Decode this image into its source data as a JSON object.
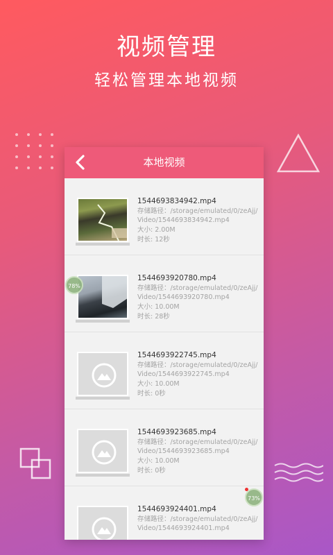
{
  "promo": {
    "headline": "视频管理",
    "subline": "轻松管理本地视频"
  },
  "appbar": {
    "title": "本地视频",
    "back_icon": "chevron-left-icon",
    "color": "#ee5a79"
  },
  "videos": [
    {
      "filename": "1544693834942.mp4",
      "path": "存储路径：/storage/emulated/0/zeAjj/Video/1544693834942.mp4",
      "size": "大小: 2.00M",
      "duration": "时长: 12秒",
      "thumb": "video-frame"
    },
    {
      "filename": "1544693920780.mp4",
      "path": "存储路径：/storage/emulated/0/zeAjj/Video/1544693920780.mp4",
      "size": "大小: 10.00M",
      "duration": "时长: 28秒",
      "thumb": "video-frame"
    },
    {
      "filename": "1544693922745.mp4",
      "path": "存储路径：/storage/emulated/0/zeAjj/Video/1544693922745.mp4",
      "size": "大小: 10.00M",
      "duration": "时长: 0秒",
      "thumb": "image-placeholder-icon"
    },
    {
      "filename": "1544693923685.mp4",
      "path": "存储路径：/storage/emulated/0/zeAjj/Video/1544693923685.mp4",
      "size": "大小: 10.00M",
      "duration": "时长: 0秒",
      "thumb": "image-placeholder-icon"
    },
    {
      "filename": "1544693924401.mp4",
      "path": "存储路径：/storage/emulated/0/zeAjj/Video/1544693924401.mp4",
      "size": "",
      "duration": "",
      "thumb": "image-placeholder-icon"
    }
  ],
  "badges": {
    "left": "78%",
    "right": "73%"
  },
  "decorations": [
    "dot-grid",
    "triangle-outline-icon",
    "squares-outline-icon",
    "waves-icon"
  ]
}
